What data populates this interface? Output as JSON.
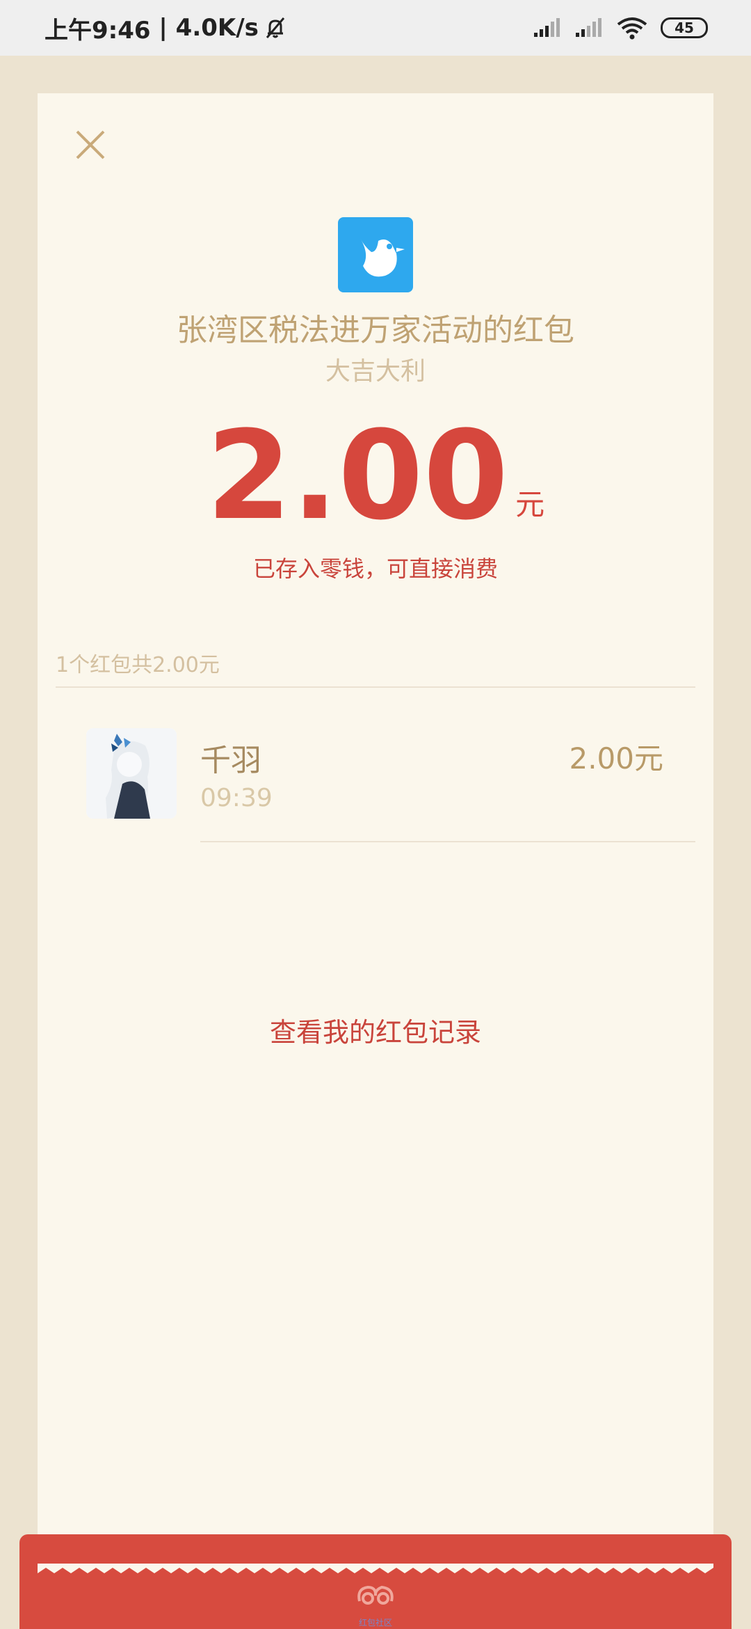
{
  "status_bar": {
    "time": "上午9:46",
    "speed": "4.0K/s",
    "battery": "45",
    "icons": [
      "mute-bell-icon",
      "signal-icon",
      "signal-icon",
      "wifi-icon",
      "battery-icon"
    ]
  },
  "packet": {
    "close_icon": "close-icon",
    "app_icon": "bird-logo-icon",
    "title": "张湾区税法进万家活动的红包",
    "greeting": "大吉大利",
    "amount": "2.00",
    "currency_unit": "元",
    "deposit_note": "已存入零钱，可直接消费",
    "summary": "1个红包共2.00元",
    "records": [
      {
        "name": "千羽",
        "time": "09:39",
        "amount": "2.00元"
      }
    ],
    "records_link": "查看我的红包记录",
    "footer_label": "红包社区"
  },
  "colors": {
    "accent_red": "#d6473d",
    "gold_text": "#bfa273",
    "card_bg": "#fbf7ec",
    "page_bg": "#ece3d0",
    "logo_blue": "#2ea8ee"
  }
}
